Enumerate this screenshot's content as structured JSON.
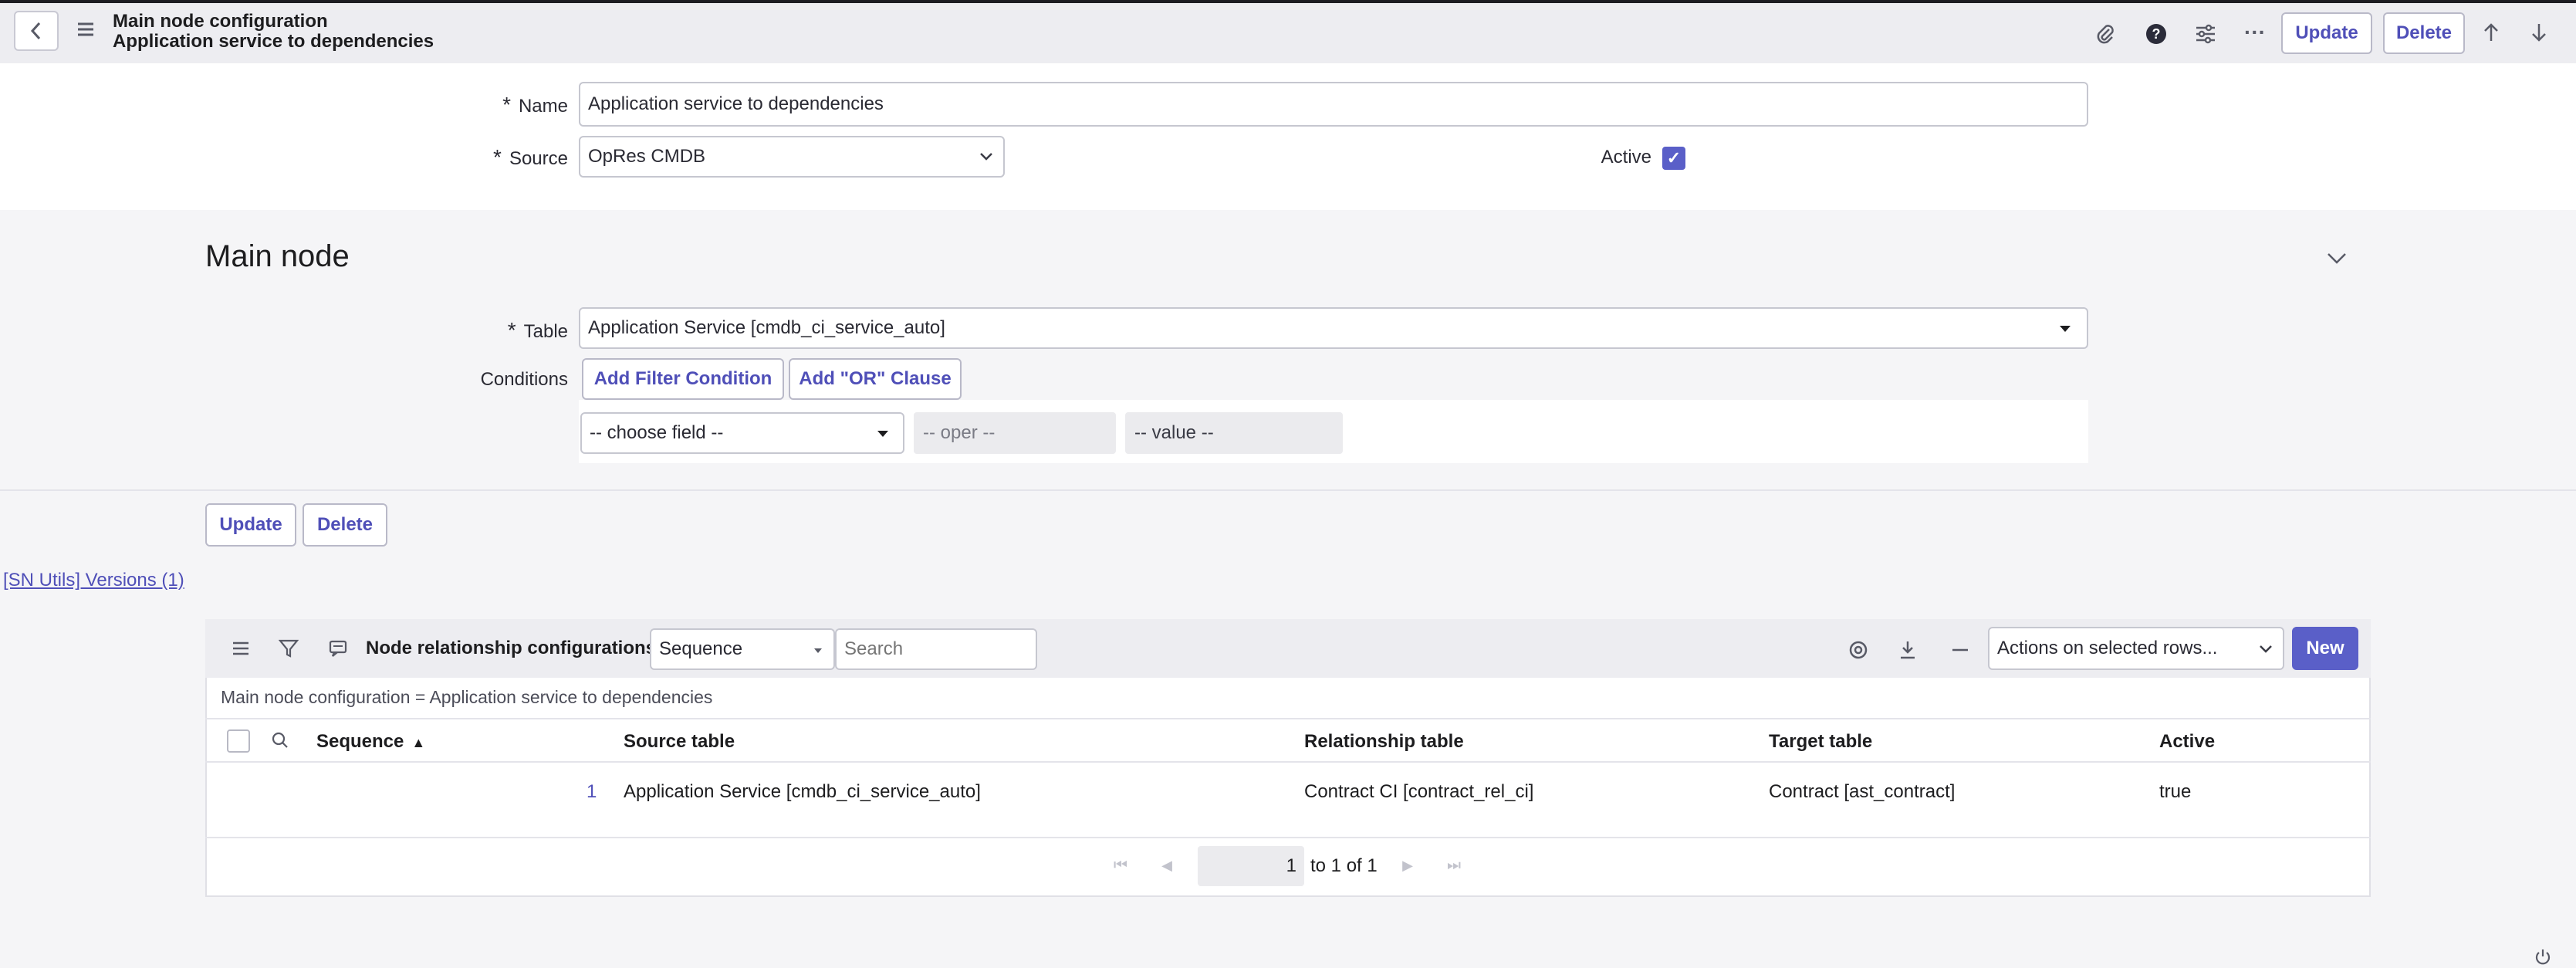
{
  "header": {
    "title_line1": "Main node configuration",
    "title_line2": "Application service to dependencies",
    "update_label": "Update",
    "delete_label": "Delete",
    "more_label": "···"
  },
  "form": {
    "name_label": "Name",
    "name_value": "Application service to dependencies",
    "source_label": "Source",
    "source_value": "OpRes CMDB",
    "active_label": "Active",
    "active_checked": true
  },
  "main_node": {
    "heading": "Main node",
    "table_label": "Table",
    "table_value": "Application Service [cmdb_ci_service_auto]",
    "conditions_label": "Conditions",
    "add_filter_label": "Add Filter Condition",
    "add_or_label": "Add \"OR\" Clause",
    "field_placeholder": "-- choose field --",
    "oper_placeholder": "-- oper --",
    "value_placeholder": "-- value --"
  },
  "bottom_buttons": {
    "update_label": "Update",
    "delete_label": "Delete"
  },
  "versions_link": "[SN Utils] Versions (1)",
  "related_list": {
    "title": "Node relationship configurations",
    "search_field": "Sequence",
    "search_placeholder": "Search",
    "actions_label": "Actions on selected rows...",
    "new_label": "New",
    "breadcrumb": "Main node configuration = Application service to dependencies",
    "columns": [
      "Sequence",
      "Source table",
      "Relationship table",
      "Target table",
      "Active"
    ],
    "rows": [
      {
        "sequence": "1",
        "source_table": "Application Service [cmdb_ci_service_auto]",
        "relationship_table": "Contract CI [contract_rel_ci]",
        "target_table": "Contract [ast_contract]",
        "active": "true"
      }
    ],
    "pagination": {
      "page_value": "1",
      "range_text": "to 1 of 1"
    }
  },
  "colors": {
    "accent": "#5a5fc8",
    "header_bg": "#ededf1"
  }
}
